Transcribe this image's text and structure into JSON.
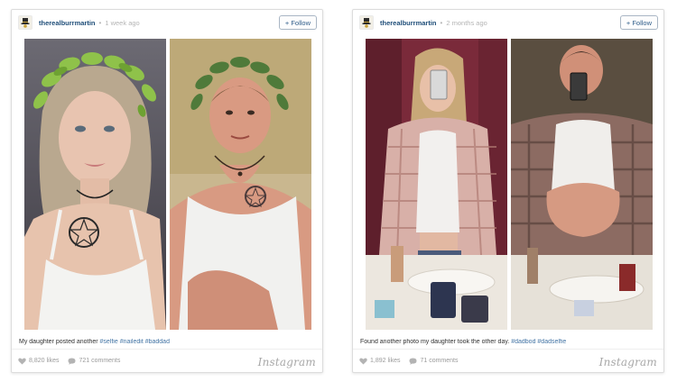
{
  "posts": [
    {
      "username": "therealburrmartin",
      "separator": "•",
      "time_ago": "1 week ago",
      "follow_label": "+ Follow",
      "caption_text": "My daughter posted another ",
      "caption_tags": "#selfie #nailedit #baddad",
      "likes": "8,820 likes",
      "comments": "721 comments",
      "brand": "Instagram",
      "photos": [
        {
          "subject": "daughter selfie with leaf crown, white tank top, chest tattoo"
        },
        {
          "subject": "dad selfie with leaf crown, white tank top, chest tattoo"
        }
      ]
    },
    {
      "username": "therealburrmartin",
      "separator": "•",
      "time_ago": "2 months ago",
      "follow_label": "+ Follow",
      "caption_text": "Found another photo my daughter took the other day. ",
      "caption_tags": "#dadbod #dadselfie",
      "likes": "1,892 likes",
      "comments": "71 comments",
      "brand": "Instagram",
      "photos": [
        {
          "subject": "daughter mirror selfie in plaid shirt, bathroom sink"
        },
        {
          "subject": "dad mirror selfie in plaid shirt, bathroom sink"
        }
      ]
    }
  ],
  "colors": {
    "username": "#1e4d78",
    "hashtag": "#4475a5",
    "muted": "#9a9a9a",
    "follow_border": "#a9b6c4"
  },
  "icons": {
    "like": "heart-icon",
    "comment": "comment-bubble-icon",
    "avatar": "top-hat-avatar-icon"
  }
}
